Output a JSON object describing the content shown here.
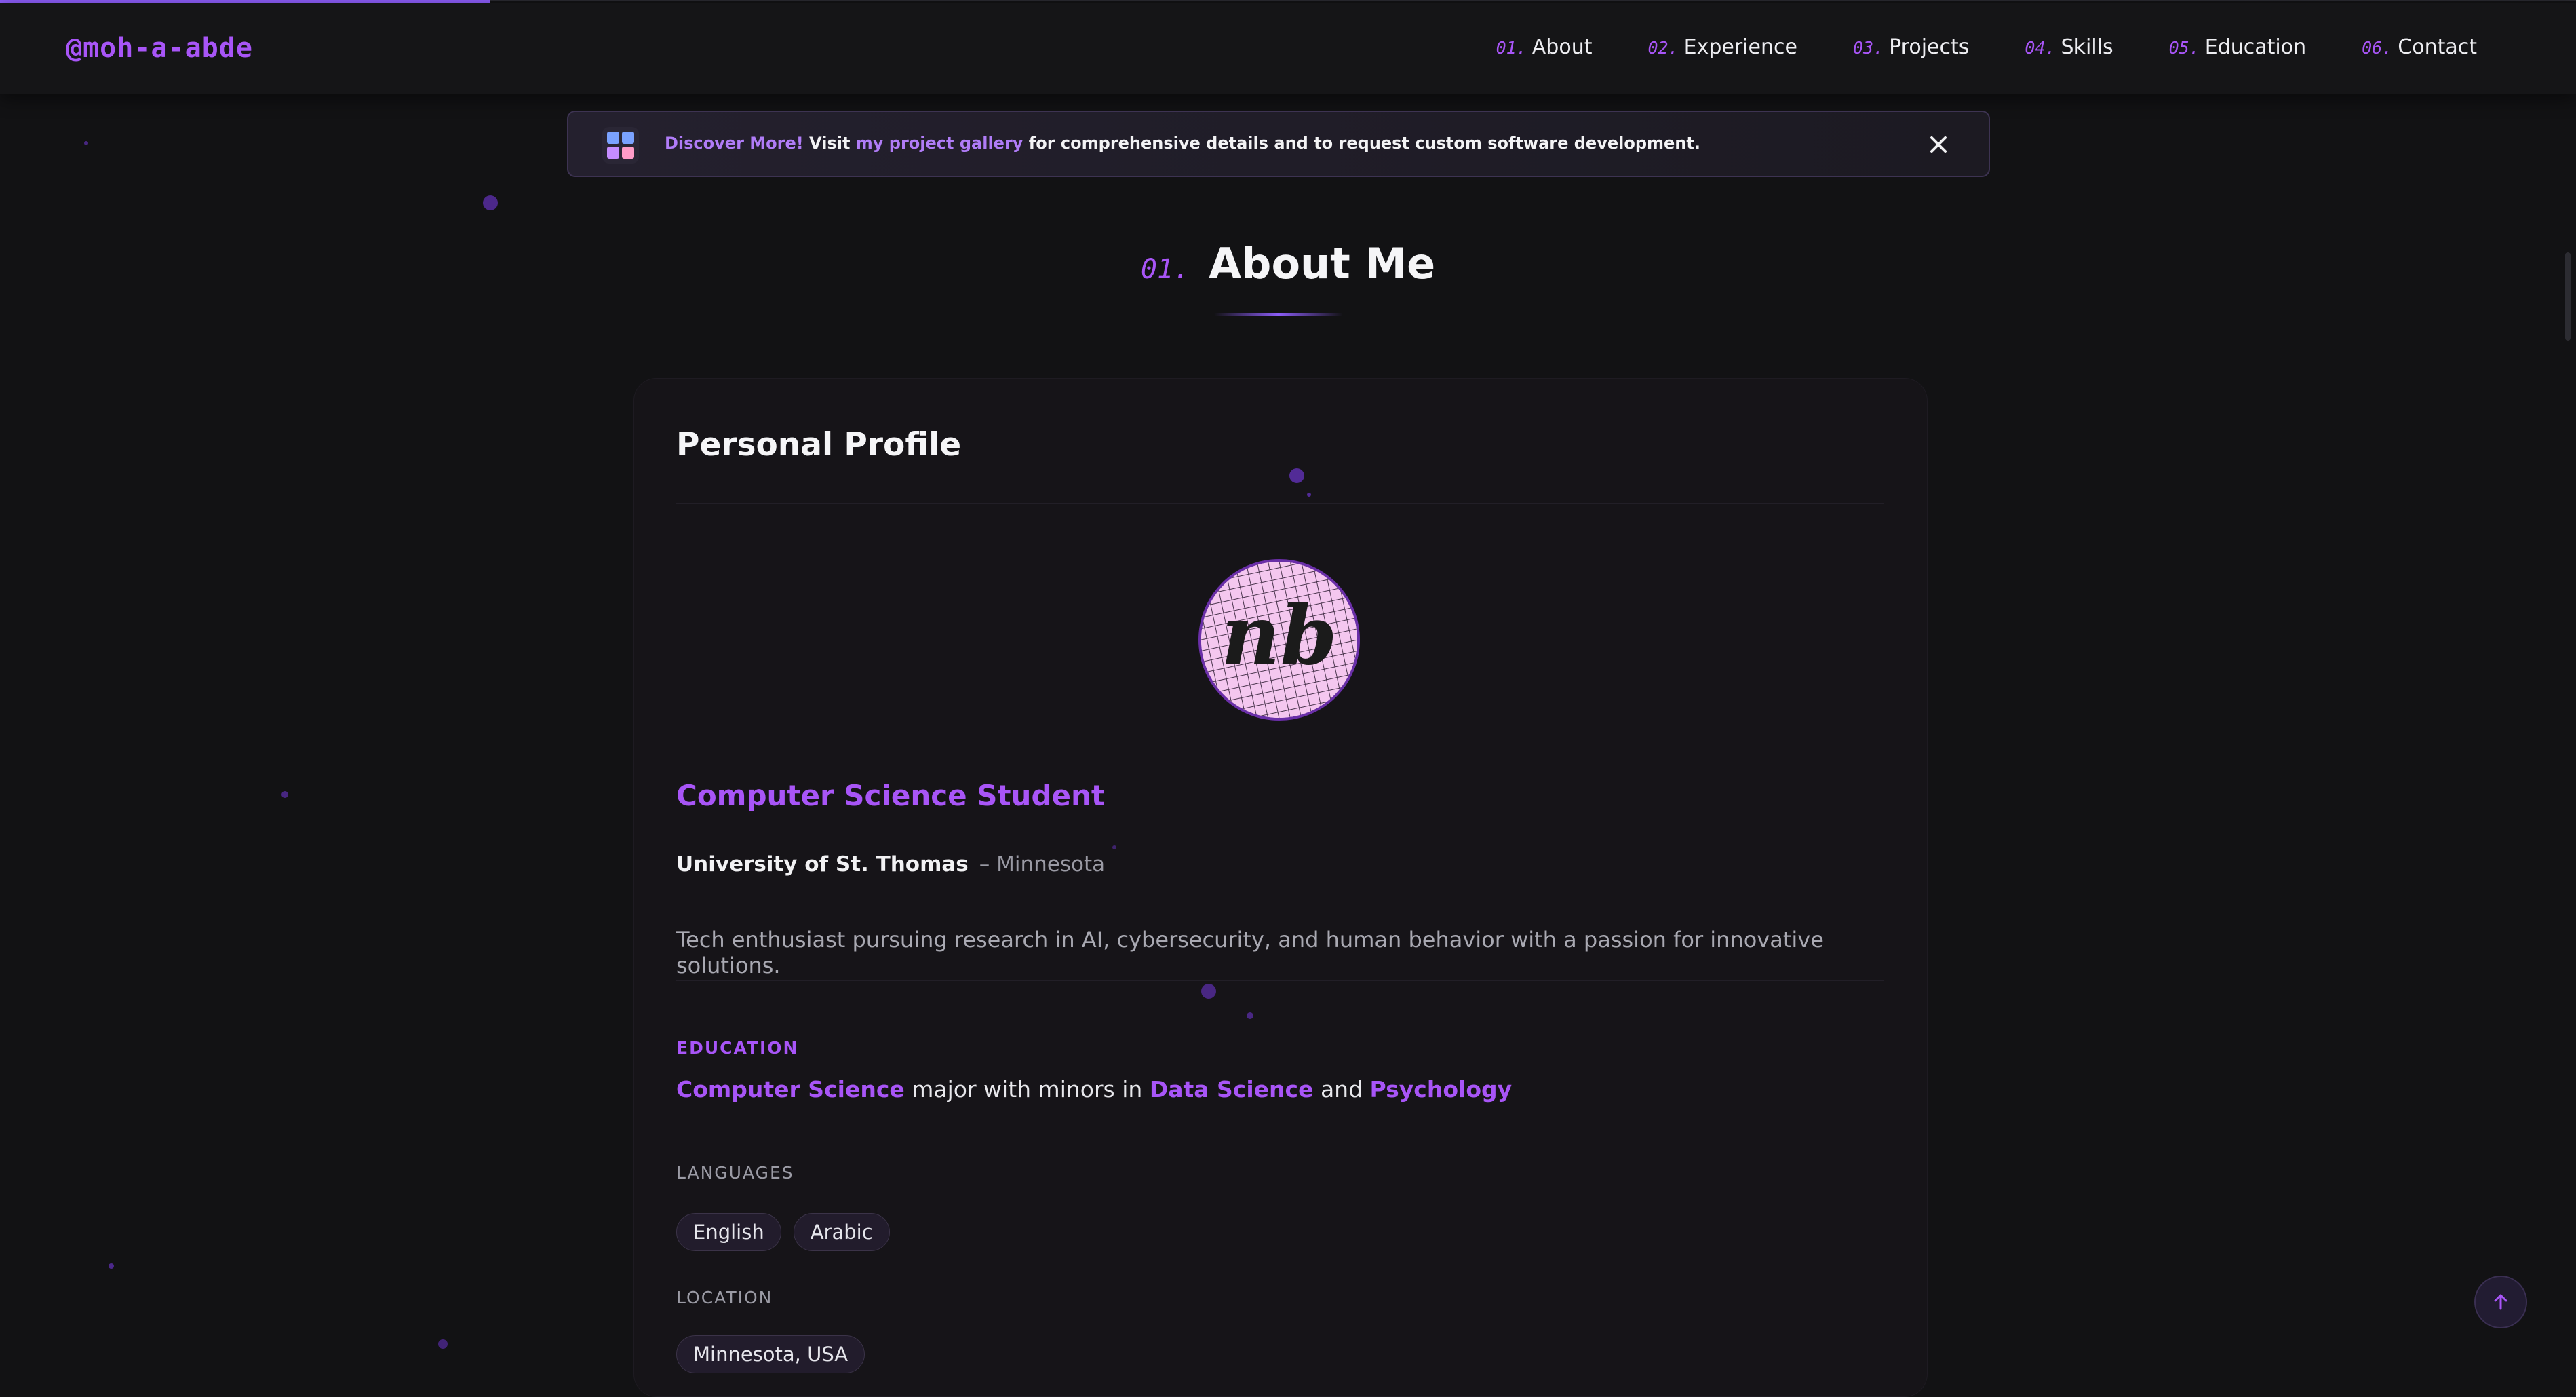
{
  "header": {
    "logo": "@moh-a-abde",
    "nav": [
      {
        "num": "01.",
        "label": "About"
      },
      {
        "num": "02.",
        "label": "Experience"
      },
      {
        "num": "03.",
        "label": "Projects"
      },
      {
        "num": "04.",
        "label": "Skills"
      },
      {
        "num": "05.",
        "label": "Education"
      },
      {
        "num": "06.",
        "label": "Contact"
      }
    ]
  },
  "page_scroll_progress": 0.19,
  "banner": {
    "lead": "Discover More!",
    "visit": " Visit ",
    "link": "my project gallery",
    "rest": " for comprehensive details and to request custom software development.",
    "icon": "grid-app-icon",
    "close_icon": "close-icon"
  },
  "section": {
    "num": "01.",
    "title": "About Me"
  },
  "profile": {
    "heading": "Personal Profile",
    "avatar_text": "nb",
    "role": "Computer Science Student",
    "university": "University of St. Thomas",
    "university_location": "– Minnesota",
    "bio": "Tech enthusiast pursuing research in AI, cybersecurity, and human behavior with a passion for innovative solutions.",
    "education_label": "EDUCATION",
    "education": {
      "major": "Computer Science",
      "mid": " major with minors in ",
      "minor1": "Data Science",
      "and": " and ",
      "minor2": "Psychology"
    },
    "languages_label": "LANGUAGES",
    "languages": [
      "English",
      "Arabic"
    ],
    "location_label": "LOCATION",
    "location": "Minnesota, USA"
  },
  "colors": {
    "accent": "#a855f7",
    "background": "#121214",
    "card": "#161418"
  },
  "fab_icon": "arrow-up-icon"
}
